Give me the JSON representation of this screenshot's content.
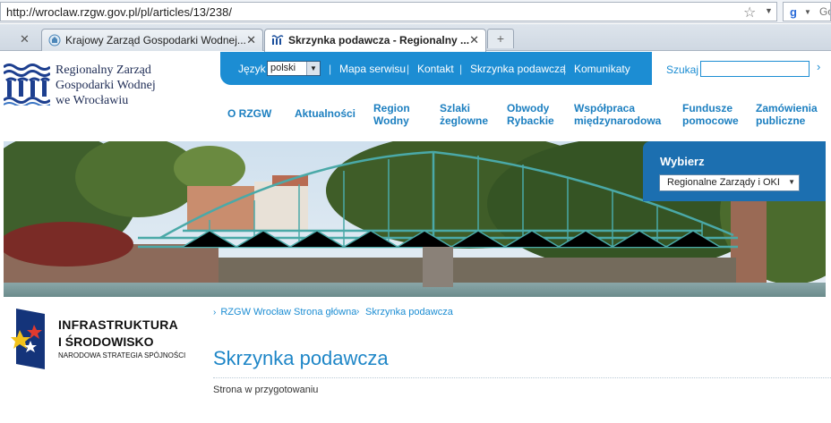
{
  "browser": {
    "url": "http://wroclaw.rzgw.gov.pl/pl/articles/13/238/",
    "search_engine_text": "Go",
    "tabs": [
      {
        "label": "Krajowy Zarząd Gospodarki Wodnej..."
      },
      {
        "label": "Skrzynka podawcza - Regionalny ..."
      }
    ],
    "new_tab_symbol": "+"
  },
  "site": {
    "logo_lines": [
      "Regionalny Zarząd",
      "Gospodarki Wodnej",
      "we Wrocławiu"
    ],
    "brand_color": "#1c8dd3",
    "top_nav": {
      "language_label": "Język",
      "language_value": "polski",
      "links": [
        "Mapa serwisu",
        "Kontakt",
        "Skrzynka podawcza",
        "Komunikaty"
      ],
      "search_label": "Szukaj",
      "search_value": ""
    },
    "main_nav": [
      {
        "label": "O RZGW"
      },
      {
        "label": "Aktualności"
      },
      {
        "label": "Region Wodny"
      },
      {
        "label": "Szlaki żeglowne"
      },
      {
        "label": "Obwody Rybackie"
      },
      {
        "label": "Współpraca międzynarodowa"
      },
      {
        "label": "Fundusze pomocowe"
      },
      {
        "label": "Zamówienia publiczne"
      }
    ],
    "selector": {
      "title": "Wybierz",
      "value": "Regionalne Zarządy i OKI"
    }
  },
  "eu_logo": {
    "line1": "INFRASTRUKTURA",
    "line2": "I ŚRODOWISKO",
    "line3": "NARODOWA STRATEGIA SPÓJNOŚCI"
  },
  "content": {
    "breadcrumb": [
      "RZGW Wrocław Strona główna",
      "Skrzynka podawcza"
    ],
    "title": "Skrzynka podawcza",
    "body": "Strona w przygotowaniu"
  }
}
